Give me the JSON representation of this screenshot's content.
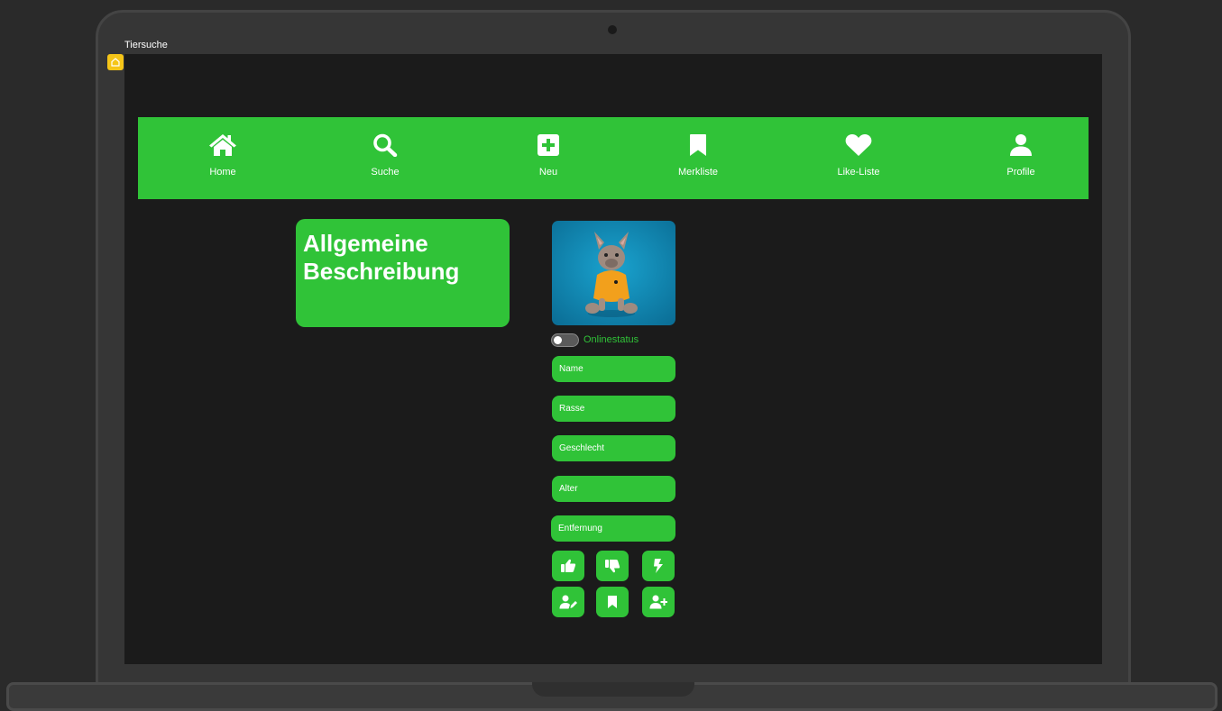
{
  "window": {
    "title": "Tiersuche"
  },
  "colors": {
    "accent": "#30c338",
    "background": "#1b1b1b",
    "text": "#ffffff"
  },
  "nav": {
    "items": [
      {
        "label": "Home",
        "icon": "home-icon"
      },
      {
        "label": "Suche",
        "icon": "search-icon"
      },
      {
        "label": "Neu",
        "icon": "plus-square-icon"
      },
      {
        "label": "Merkliste",
        "icon": "bookmark-icon"
      },
      {
        "label": "Like-Liste",
        "icon": "heart-icon"
      },
      {
        "label": "Profile",
        "icon": "user-icon"
      }
    ]
  },
  "description": {
    "title": "Allgemeine Beschreibung"
  },
  "profile": {
    "photo_icon": "dog-photo",
    "online_status_label": "Onlinestatus",
    "online": false,
    "fields": {
      "name": "Name",
      "breed": "Rasse",
      "gender": "Geschlecht",
      "age": "Alter",
      "distance": "Entfernung"
    }
  },
  "actions": [
    {
      "icon": "thumbs-up-icon"
    },
    {
      "icon": "thumbs-down-icon"
    },
    {
      "icon": "lightning-icon"
    },
    {
      "icon": "user-edit-icon"
    },
    {
      "icon": "bookmark-icon"
    },
    {
      "icon": "user-plus-icon"
    }
  ]
}
